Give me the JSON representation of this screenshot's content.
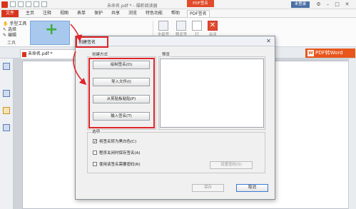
{
  "titlebar": {
    "title": "未命名.pdf * - 福昕阅读器",
    "context_tab": "PDF签名",
    "login": "未登录"
  },
  "menu": {
    "file": "文件",
    "items": [
      "主页",
      "注释",
      "视图",
      "表单",
      "保护",
      "共享",
      "浏览",
      "特色功能",
      "帮助"
    ],
    "active": "PDF签名"
  },
  "ribbon": {
    "tools": [
      "手型工具",
      "选择",
      "编辑"
    ],
    "tools_group": "工具",
    "buttons": [
      "全部签",
      "预览签",
      "打",
      "关闭"
    ],
    "plus": "+"
  },
  "docbar": {
    "tab": "未命名.pdf *",
    "pdf2word": "PDF转Word"
  },
  "dialog": {
    "title": "创建签名",
    "mode_group": "创建方式",
    "mode_buttons": [
      "绘制签名(D)",
      "导入文件(I)",
      "从剪贴板粘贴(P)",
      "输入签名(T)"
    ],
    "preview_group": "预览",
    "options_group": "选项",
    "options": [
      {
        "label": "将签名转为黑白色(C)",
        "checked": true
      },
      {
        "label": "程序关闭时保存签名(A)",
        "checked": false
      },
      {
        "label": "使用该签名需要密码(R)",
        "checked": false
      }
    ],
    "set_password": "设置密码(S)",
    "save": "保存",
    "cancel": "取消"
  },
  "colors": {
    "accent": "#e0252a",
    "brand": "#d9341c",
    "plus": "#3fae3a"
  }
}
